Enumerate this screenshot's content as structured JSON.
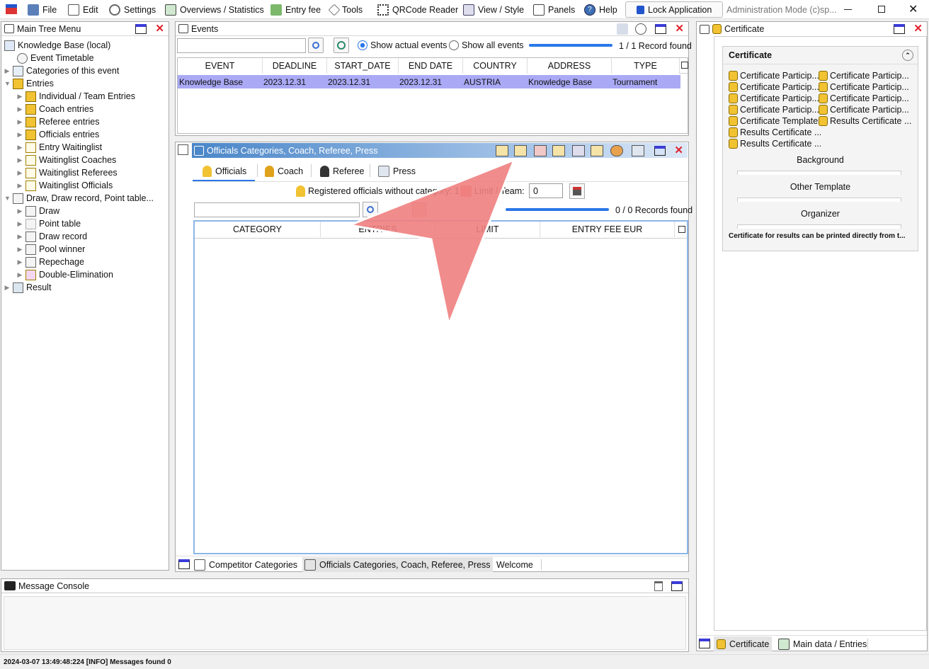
{
  "menu": {
    "file": "File",
    "edit": "Edit",
    "settings": "Settings",
    "overviews": "Overviews / Statistics",
    "entry_fee": "Entry fee",
    "tools": "Tools",
    "qr": "QRCode Reader",
    "view": "View / Style",
    "panels": "Panels",
    "help": "Help",
    "lock": "Lock Application",
    "admin": "Administration Mode (c)sp..."
  },
  "tree": {
    "title": "Main Tree Menu",
    "items": [
      {
        "label": "Knowledge Base (local)"
      },
      {
        "label": "Event Timetable"
      },
      {
        "label": "Categories of this event"
      },
      {
        "label": "Entries"
      },
      {
        "label": "Individual / Team Entries"
      },
      {
        "label": "Coach entries"
      },
      {
        "label": "Referee entries"
      },
      {
        "label": "Officials entries"
      },
      {
        "label": "Entry Waitinglist"
      },
      {
        "label": "Waitinglist Coaches"
      },
      {
        "label": "Waitinglist Referees"
      },
      {
        "label": "Waitinglist Officials"
      },
      {
        "label": "Draw, Draw record, Point table..."
      },
      {
        "label": "Draw"
      },
      {
        "label": "Point table"
      },
      {
        "label": "Draw record"
      },
      {
        "label": "Pool winner"
      },
      {
        "label": "Repechage"
      },
      {
        "label": "Double-Elimination"
      },
      {
        "label": "Result"
      }
    ]
  },
  "events": {
    "title": "Events",
    "show_actual": "Show actual events",
    "show_all": "Show all events",
    "record_count": "1 / 1 Record found",
    "columns": [
      "EVENT",
      "DEADLINE",
      "START_DATE",
      "END DATE",
      "COUNTRY",
      "ADDRESS",
      "TYPE"
    ],
    "rows": [
      [
        "Knowledge Base",
        "2023.12.31",
        "2023.12.31",
        "2023.12.31",
        "AUSTRIA",
        "Knowledge Base",
        "Tournament"
      ]
    ]
  },
  "officials": {
    "title": "Officials Categories, Coach, Referee, Press",
    "tabs": [
      "Officials",
      "Coach",
      "Referee",
      "Press"
    ],
    "registered_label": "Registered officials without category: 1",
    "limit_label": "Limit / Team:",
    "limit_value": "0",
    "record_count": "0 / 0 Records found",
    "columns": [
      "CATEGORY",
      "ENTRIES",
      "LIMIT",
      "ENTRY FEE EUR"
    ],
    "bottom_tabs": [
      "Competitor Categories",
      "Officials Categories, Coach, Referee, Press",
      "Welcome"
    ]
  },
  "certificate": {
    "title": "Certificate",
    "section_title": "Certificate",
    "items_left": [
      "Certificate Particip...",
      "Certificate Particip...",
      "Certificate Particip...",
      "Certificate Particip...",
      "Certificate Template",
      "Results Certificate ...",
      "Results Certificate ..."
    ],
    "items_right": [
      "Certificate Particip...",
      "Certificate Particip...",
      "Certificate Particip...",
      "Certificate Particip...",
      "Results Certificate ..."
    ],
    "background_label": "Background",
    "other_template_label": "Other Template",
    "organizer_label": "Organizer",
    "note": "Certificate for results can be printed directly from t...",
    "bottom_tabs": [
      "Certificate",
      "Main data / Entries"
    ]
  },
  "console": {
    "title": "Message Console"
  },
  "status": {
    "text": "2024-03-07 13:49:48:224 [INFO] Messages found 0"
  },
  "colors": {
    "accent": "#2b77e8",
    "selected_row": "#a9a9f5",
    "close_red": "#e0202a",
    "officials_header": "#4a86c8",
    "overlay_arrow": "#f08080"
  }
}
